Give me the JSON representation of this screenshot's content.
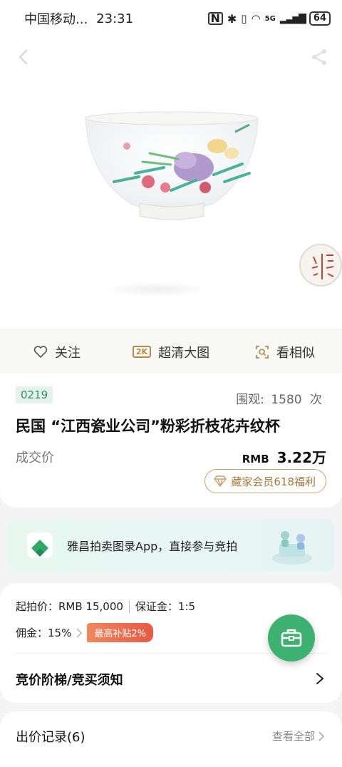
{
  "status_bar": {
    "carrier": "中国移动...",
    "time": "23:31",
    "network": "5G",
    "battery": "64"
  },
  "actions": {
    "follow": "关注",
    "hd_badge": "2K",
    "hd_image": "超清大图",
    "similar": "看相似"
  },
  "lot": {
    "number": "0219",
    "views_label": "围观:",
    "views_count": "1580",
    "views_unit": "次",
    "title": "民国 “江西瓷业公司”粉彩折枝花卉纹杯",
    "price_label": "成交价",
    "currency": "RMB",
    "price": "3.22万",
    "vip_button": "藏家会员618福利"
  },
  "banner": {
    "text": "雅昌拍卖图录App，直接参与竞拍"
  },
  "terms": {
    "start_price": "起拍价：RMB 15,000",
    "deposit": "保证金：1:5",
    "commission": "佣金：15%",
    "subsidy": "最高补贴2%",
    "rules": "竞价阶梯/竞买须知"
  },
  "records": {
    "title": "出价记录(6)",
    "view_all": "查看全部"
  },
  "colors": {
    "brand_green": "#3db16f",
    "lot_tag_text": "#2e9467",
    "gold": "#c9a36b",
    "subsidy": "#e65a45"
  }
}
